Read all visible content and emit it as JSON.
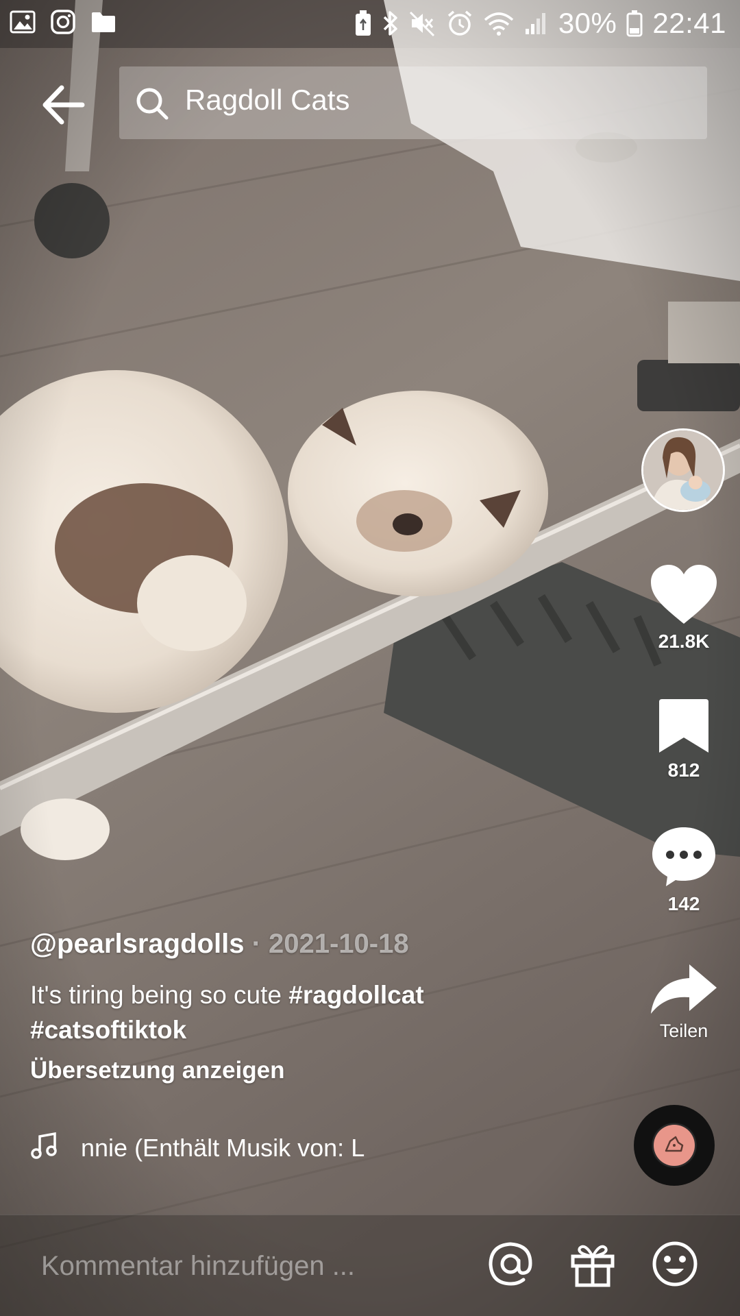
{
  "status_bar": {
    "battery_percent": "30%",
    "time": "22:41",
    "left_icons": [
      "gallery-icon",
      "instagram-icon",
      "folder-icon"
    ],
    "right_icons": [
      "battery-saver-icon",
      "bluetooth-icon",
      "mute-icon",
      "alarm-icon",
      "wifi-icon",
      "signal-icon",
      "battery-icon"
    ]
  },
  "header": {
    "search_query": "Ragdoll Cats"
  },
  "actions": {
    "likes": "21.8K",
    "saves": "812",
    "comments": "142",
    "share_label": "Teilen"
  },
  "post": {
    "author": "@pearlsragdolls",
    "separator": " · ",
    "date": "2021-10-18",
    "description": "It's tiring being so cute ",
    "hashtag_1": "#ragdollcat",
    "hashtag_2": "#catsoftiktok",
    "translate_label": "Übersetzung anzeigen",
    "music": "nnie (Enthält Musik von: L"
  },
  "comment_bar": {
    "placeholder": "Kommentar hinzufügen ..."
  }
}
